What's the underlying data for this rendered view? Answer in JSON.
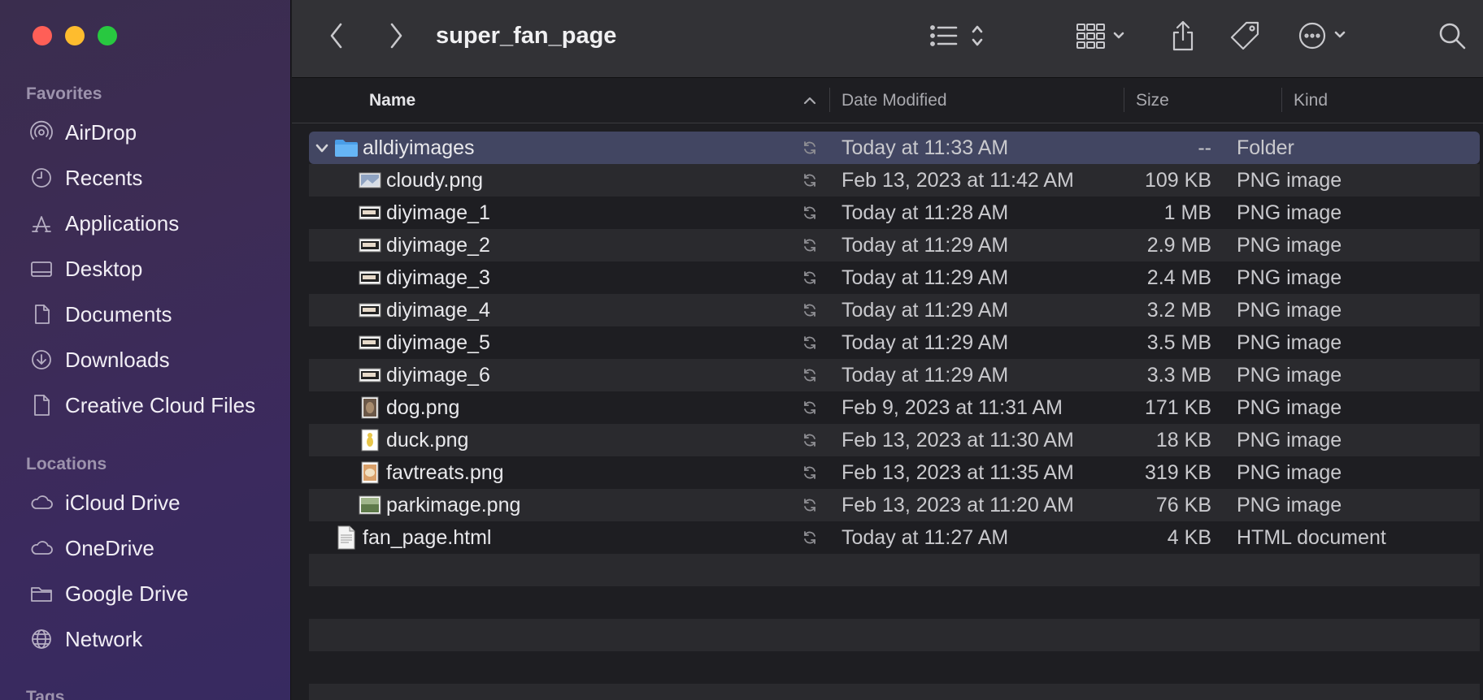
{
  "window": {
    "title": "super_fan_page"
  },
  "sidebar": {
    "favorites_heading": "Favorites",
    "favorites": [
      {
        "label": "AirDrop",
        "icon": "airdrop-icon"
      },
      {
        "label": "Recents",
        "icon": "clock-icon"
      },
      {
        "label": "Applications",
        "icon": "applications-icon"
      },
      {
        "label": "Desktop",
        "icon": "desktop-icon"
      },
      {
        "label": "Documents",
        "icon": "document-icon"
      },
      {
        "label": "Downloads",
        "icon": "download-icon"
      },
      {
        "label": "Creative Cloud Files",
        "icon": "file-icon"
      }
    ],
    "locations_heading": "Locations",
    "locations": [
      {
        "label": "iCloud Drive",
        "icon": "cloud-icon"
      },
      {
        "label": "OneDrive",
        "icon": "cloud-icon"
      },
      {
        "label": "Google Drive",
        "icon": "folder-icon"
      },
      {
        "label": "Network",
        "icon": "globe-icon"
      }
    ],
    "tags_heading": "Tags"
  },
  "columns": {
    "name": "Name",
    "date": "Date Modified",
    "size": "Size",
    "kind": "Kind"
  },
  "files": [
    {
      "name": "alldiyimages",
      "date": "Today at 11:33 AM",
      "size": "--",
      "kind": "Folder",
      "type": "folder",
      "level": 0,
      "expanded": true,
      "selected": true
    },
    {
      "name": "cloudy.png",
      "date": "Feb 13, 2023 at 11:42 AM",
      "size": "109 KB",
      "kind": "PNG image",
      "type": "image",
      "level": 1
    },
    {
      "name": "diyimage_1",
      "date": "Today at 11:28 AM",
      "size": "1 MB",
      "kind": "PNG image",
      "type": "screenshot",
      "level": 1
    },
    {
      "name": "diyimage_2",
      "date": "Today at 11:29 AM",
      "size": "2.9 MB",
      "kind": "PNG image",
      "type": "screenshot",
      "level": 1
    },
    {
      "name": "diyimage_3",
      "date": "Today at 11:29 AM",
      "size": "2.4 MB",
      "kind": "PNG image",
      "type": "screenshot",
      "level": 1
    },
    {
      "name": "diyimage_4",
      "date": "Today at 11:29 AM",
      "size": "3.2 MB",
      "kind": "PNG image",
      "type": "screenshot",
      "level": 1
    },
    {
      "name": "diyimage_5",
      "date": "Today at 11:29 AM",
      "size": "3.5 MB",
      "kind": "PNG image",
      "type": "screenshot",
      "level": 1
    },
    {
      "name": "diyimage_6",
      "date": "Today at 11:29 AM",
      "size": "3.3 MB",
      "kind": "PNG image",
      "type": "screenshot",
      "level": 1
    },
    {
      "name": "dog.png",
      "date": "Feb 9, 2023 at 11:31 AM",
      "size": "171 KB",
      "kind": "PNG image",
      "type": "photo-dog",
      "level": 1
    },
    {
      "name": "duck.png",
      "date": "Feb 13, 2023 at 11:30 AM",
      "size": "18 KB",
      "kind": "PNG image",
      "type": "photo-duck",
      "level": 1
    },
    {
      "name": "favtreats.png",
      "date": "Feb 13, 2023 at 11:35 AM",
      "size": "319 KB",
      "kind": "PNG image",
      "type": "photo-treats",
      "level": 1
    },
    {
      "name": "parkimage.png",
      "date": "Feb 13, 2023 at 11:20 AM",
      "size": "76 KB",
      "kind": "PNG image",
      "type": "photo-park",
      "level": 1
    },
    {
      "name": "fan_page.html",
      "date": "Today at 11:27 AM",
      "size": "4 KB",
      "kind": "HTML document",
      "type": "html",
      "level": 0
    }
  ],
  "colors": {
    "selection": "#424662",
    "sidebar": "#3b2a5e",
    "folder": "#5aa9f0"
  }
}
